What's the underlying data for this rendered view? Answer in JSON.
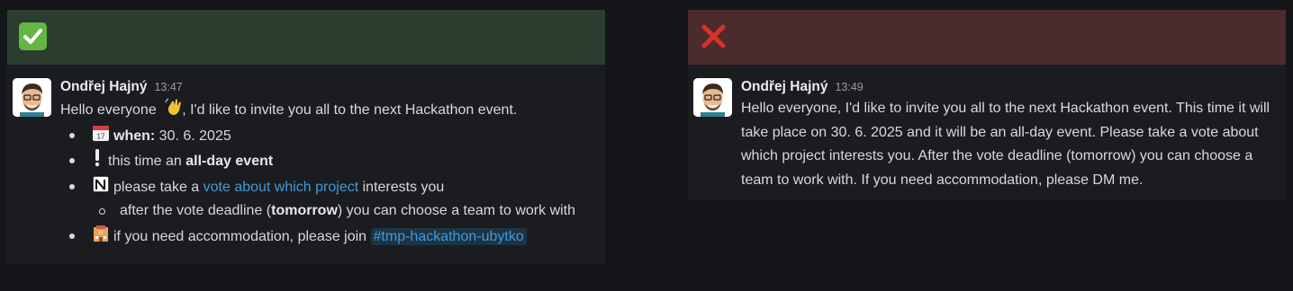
{
  "good": {
    "author": "Ondřej Hajný",
    "time": "13:47",
    "greeting": "Hello everyone",
    "greeting_rest": ", I'd like to invite you all to the next Hackathon event.",
    "b1_label": "when:",
    "b1_value": " 30. 6. 2025",
    "b2_pre": "this time an ",
    "b2_bold": "all-day event",
    "b3_pre": "please take a ",
    "b3_link": "vote about which project",
    "b3_post": " interests you",
    "sub_pre": "after the vote deadline (",
    "sub_bold": "tomorrow",
    "sub_post": ") you can choose a team to work with",
    "b4_pre": "if you need accommodation, please join ",
    "b4_channel": "#tmp-hackathon-ubytko"
  },
  "bad": {
    "author": "Ondřej Hajný",
    "time": "13:49",
    "text": "Hello everyone, I'd like to invite you all to the next Hackathon event. This time it will take place on 30. 6. 2025 and it will be an all-day event. Please take a vote about which project interests you. After the vote deadline (tomorrow) you can choose a team to work with. If you need accommodation, please DM me."
  },
  "colors": {
    "good_banner": "#2a3d2e",
    "bad_banner": "#4b2b2b",
    "link": "#3f9ad8",
    "check": "#65b544",
    "cross": "#d9302c"
  },
  "icons": [
    "check-mark-icon",
    "cross-mark-icon",
    "wave-emoji-icon",
    "calendar-emoji-icon",
    "exclamation-emoji-icon",
    "notion-logo-icon",
    "hotel-emoji-icon"
  ]
}
